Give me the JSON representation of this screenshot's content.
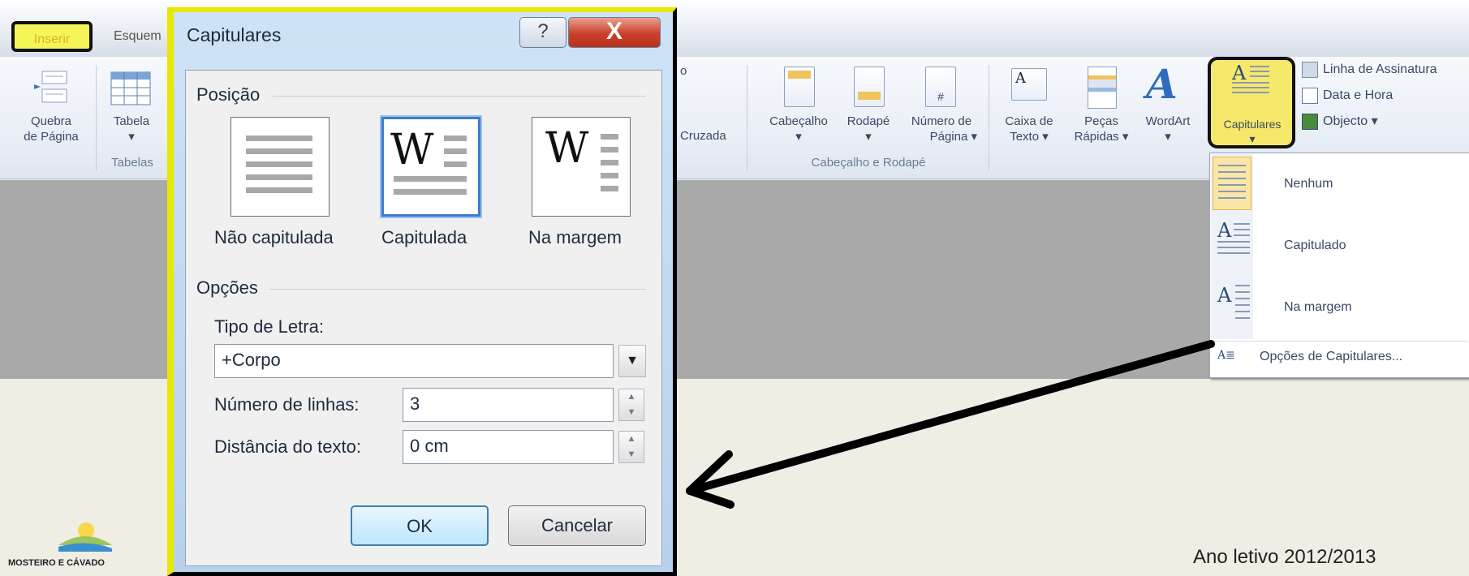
{
  "ribbon": {
    "tabs": [
      "Inserir",
      "Esquem"
    ],
    "items": {
      "quebra": [
        "Quebra",
        "de Página"
      ],
      "tabela": "Tabela",
      "tabelas_group": "Tabelas",
      "partial_letter": "o",
      "cruzada": "Cruzada",
      "cabecalho": "Cabeçalho",
      "rodape": "Rodapé",
      "numero": [
        "Número de",
        "Página ▾"
      ],
      "cab_group": "Cabeçalho e Rodapé",
      "caixa": [
        "Caixa de",
        "Texto ▾"
      ],
      "pecas": [
        "Peças",
        "Rápidas ▾"
      ],
      "wordart": "WordArt",
      "capitulares": "Capitulares",
      "linha": "Linha de Assinatura",
      "data_hora": "Data e Hora",
      "objecto": "Objecto ▾"
    }
  },
  "dialog": {
    "title": "Capitulares",
    "help": "?",
    "close": "X",
    "posicao_label": "Posição",
    "positions": [
      "Não capitulada",
      "Capitulada",
      "Na margem"
    ],
    "opcoes_label": "Opções",
    "tipo_label": "Tipo de Letra:",
    "font_value": "+Corpo",
    "linhas_label": "Número de linhas:",
    "linhas_value": "3",
    "distancia_label": "Distância do texto:",
    "distancia_value": "0 cm",
    "ok": "OK",
    "cancel": "Cancelar"
  },
  "dropdown": {
    "items": [
      "Nenhum",
      "Capitulado",
      "Na margem"
    ],
    "options": "Opções de Capitulares..."
  },
  "footer": "Ano letivo 2012/2013",
  "logo": "MOSTEIRO E CÁVADO",
  "colors": {
    "highlight": "#f6e86a",
    "frame": "#e8e800",
    "selection": "#3d7bd1"
  }
}
